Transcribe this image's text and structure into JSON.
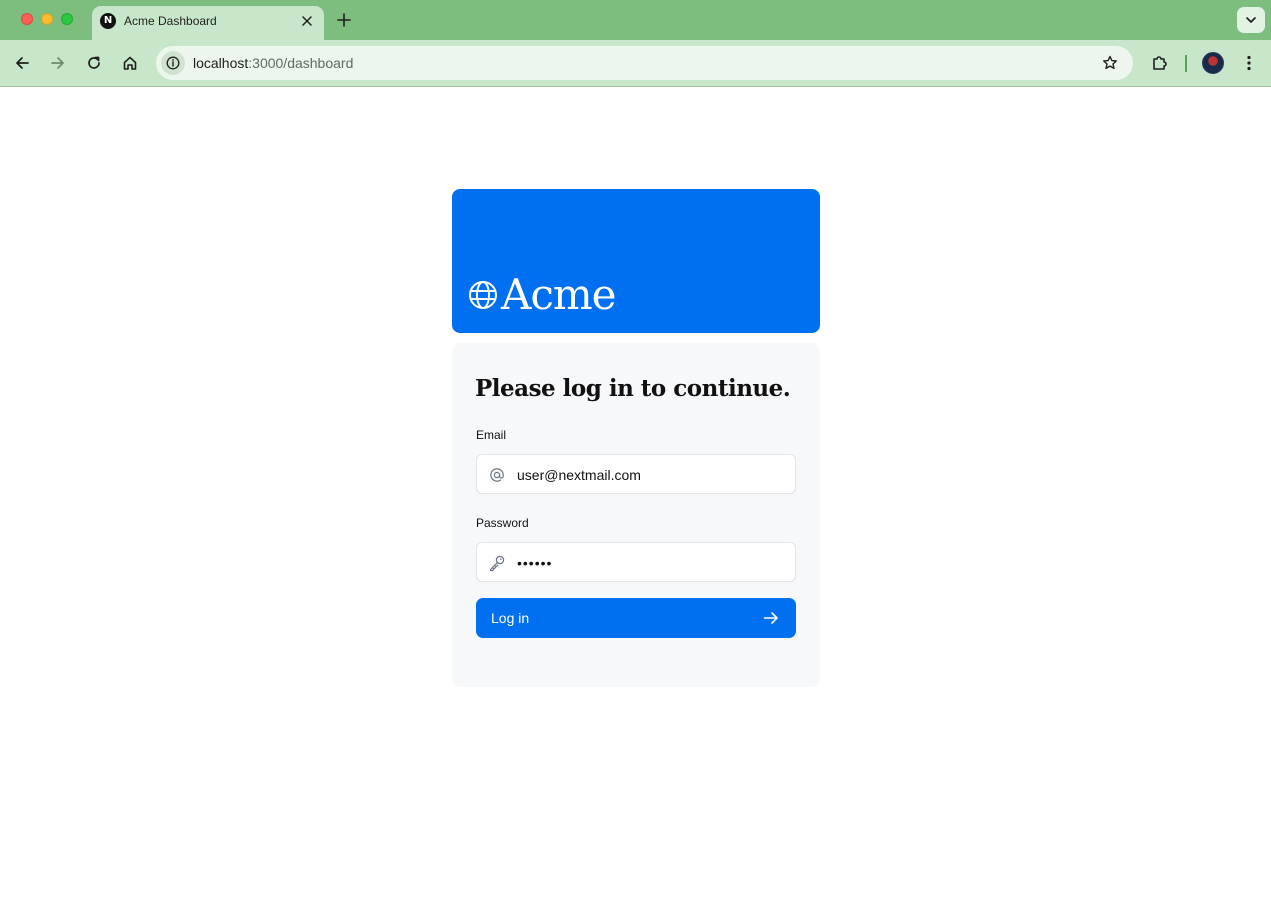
{
  "browser": {
    "tab": {
      "title": "Acme Dashboard",
      "favicon": "N"
    },
    "url": {
      "host": "localhost",
      "path": ":3000/dashboard"
    },
    "icons": [
      "back-icon",
      "forward-icon",
      "reload-icon",
      "home-icon",
      "info-icon",
      "star-icon",
      "extensions-icon",
      "menu-icon"
    ]
  },
  "brand": {
    "name": "Acme",
    "color": "#0070f0"
  },
  "login": {
    "heading": "Please log in to continue.",
    "email_label": "Email",
    "email_value": "user@nextmail.com",
    "password_label": "Password",
    "password_value": "••••••",
    "submit_label": "Log in"
  }
}
